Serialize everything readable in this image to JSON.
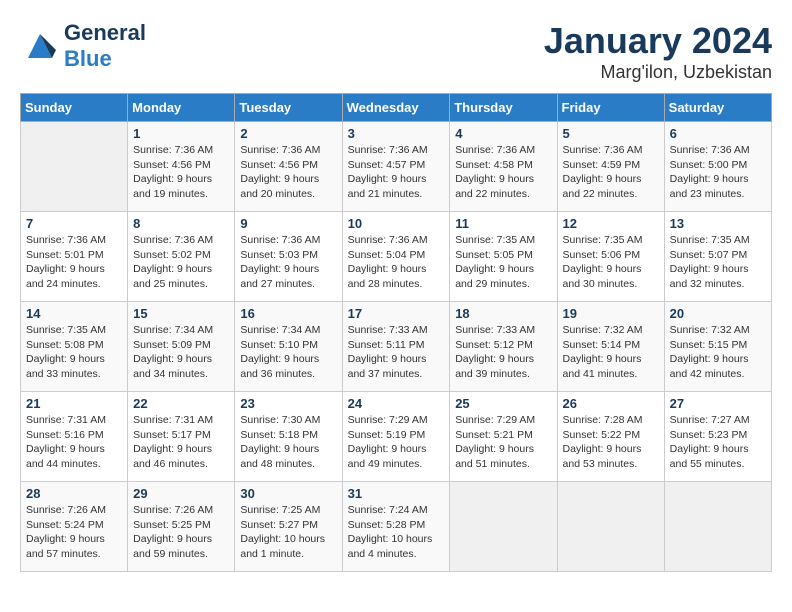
{
  "header": {
    "logo_general": "General",
    "logo_blue": "Blue",
    "month": "January 2024",
    "location": "Marg'ilon, Uzbekistan"
  },
  "weekdays": [
    "Sunday",
    "Monday",
    "Tuesday",
    "Wednesday",
    "Thursday",
    "Friday",
    "Saturday"
  ],
  "weeks": [
    [
      {
        "day": "",
        "sunrise": "",
        "sunset": "",
        "daylight": ""
      },
      {
        "day": "1",
        "sunrise": "7:36 AM",
        "sunset": "4:56 PM",
        "daylight": "9 hours and 19 minutes."
      },
      {
        "day": "2",
        "sunrise": "7:36 AM",
        "sunset": "4:56 PM",
        "daylight": "9 hours and 20 minutes."
      },
      {
        "day": "3",
        "sunrise": "7:36 AM",
        "sunset": "4:57 PM",
        "daylight": "9 hours and 21 minutes."
      },
      {
        "day": "4",
        "sunrise": "7:36 AM",
        "sunset": "4:58 PM",
        "daylight": "9 hours and 22 minutes."
      },
      {
        "day": "5",
        "sunrise": "7:36 AM",
        "sunset": "4:59 PM",
        "daylight": "9 hours and 22 minutes."
      },
      {
        "day": "6",
        "sunrise": "7:36 AM",
        "sunset": "5:00 PM",
        "daylight": "9 hours and 23 minutes."
      }
    ],
    [
      {
        "day": "7",
        "sunrise": "7:36 AM",
        "sunset": "5:01 PM",
        "daylight": "9 hours and 24 minutes."
      },
      {
        "day": "8",
        "sunrise": "7:36 AM",
        "sunset": "5:02 PM",
        "daylight": "9 hours and 25 minutes."
      },
      {
        "day": "9",
        "sunrise": "7:36 AM",
        "sunset": "5:03 PM",
        "daylight": "9 hours and 27 minutes."
      },
      {
        "day": "10",
        "sunrise": "7:36 AM",
        "sunset": "5:04 PM",
        "daylight": "9 hours and 28 minutes."
      },
      {
        "day": "11",
        "sunrise": "7:35 AM",
        "sunset": "5:05 PM",
        "daylight": "9 hours and 29 minutes."
      },
      {
        "day": "12",
        "sunrise": "7:35 AM",
        "sunset": "5:06 PM",
        "daylight": "9 hours and 30 minutes."
      },
      {
        "day": "13",
        "sunrise": "7:35 AM",
        "sunset": "5:07 PM",
        "daylight": "9 hours and 32 minutes."
      }
    ],
    [
      {
        "day": "14",
        "sunrise": "7:35 AM",
        "sunset": "5:08 PM",
        "daylight": "9 hours and 33 minutes."
      },
      {
        "day": "15",
        "sunrise": "7:34 AM",
        "sunset": "5:09 PM",
        "daylight": "9 hours and 34 minutes."
      },
      {
        "day": "16",
        "sunrise": "7:34 AM",
        "sunset": "5:10 PM",
        "daylight": "9 hours and 36 minutes."
      },
      {
        "day": "17",
        "sunrise": "7:33 AM",
        "sunset": "5:11 PM",
        "daylight": "9 hours and 37 minutes."
      },
      {
        "day": "18",
        "sunrise": "7:33 AM",
        "sunset": "5:12 PM",
        "daylight": "9 hours and 39 minutes."
      },
      {
        "day": "19",
        "sunrise": "7:32 AM",
        "sunset": "5:14 PM",
        "daylight": "9 hours and 41 minutes."
      },
      {
        "day": "20",
        "sunrise": "7:32 AM",
        "sunset": "5:15 PM",
        "daylight": "9 hours and 42 minutes."
      }
    ],
    [
      {
        "day": "21",
        "sunrise": "7:31 AM",
        "sunset": "5:16 PM",
        "daylight": "9 hours and 44 minutes."
      },
      {
        "day": "22",
        "sunrise": "7:31 AM",
        "sunset": "5:17 PM",
        "daylight": "9 hours and 46 minutes."
      },
      {
        "day": "23",
        "sunrise": "7:30 AM",
        "sunset": "5:18 PM",
        "daylight": "9 hours and 48 minutes."
      },
      {
        "day": "24",
        "sunrise": "7:29 AM",
        "sunset": "5:19 PM",
        "daylight": "9 hours and 49 minutes."
      },
      {
        "day": "25",
        "sunrise": "7:29 AM",
        "sunset": "5:21 PM",
        "daylight": "9 hours and 51 minutes."
      },
      {
        "day": "26",
        "sunrise": "7:28 AM",
        "sunset": "5:22 PM",
        "daylight": "9 hours and 53 minutes."
      },
      {
        "day": "27",
        "sunrise": "7:27 AM",
        "sunset": "5:23 PM",
        "daylight": "9 hours and 55 minutes."
      }
    ],
    [
      {
        "day": "28",
        "sunrise": "7:26 AM",
        "sunset": "5:24 PM",
        "daylight": "9 hours and 57 minutes."
      },
      {
        "day": "29",
        "sunrise": "7:26 AM",
        "sunset": "5:25 PM",
        "daylight": "9 hours and 59 minutes."
      },
      {
        "day": "30",
        "sunrise": "7:25 AM",
        "sunset": "5:27 PM",
        "daylight": "10 hours and 1 minute."
      },
      {
        "day": "31",
        "sunrise": "7:24 AM",
        "sunset": "5:28 PM",
        "daylight": "10 hours and 4 minutes."
      },
      {
        "day": "",
        "sunrise": "",
        "sunset": "",
        "daylight": ""
      },
      {
        "day": "",
        "sunrise": "",
        "sunset": "",
        "daylight": ""
      },
      {
        "day": "",
        "sunrise": "",
        "sunset": "",
        "daylight": ""
      }
    ]
  ],
  "labels": {
    "sunrise_prefix": "Sunrise: ",
    "sunset_prefix": "Sunset: ",
    "daylight_prefix": "Daylight: "
  }
}
